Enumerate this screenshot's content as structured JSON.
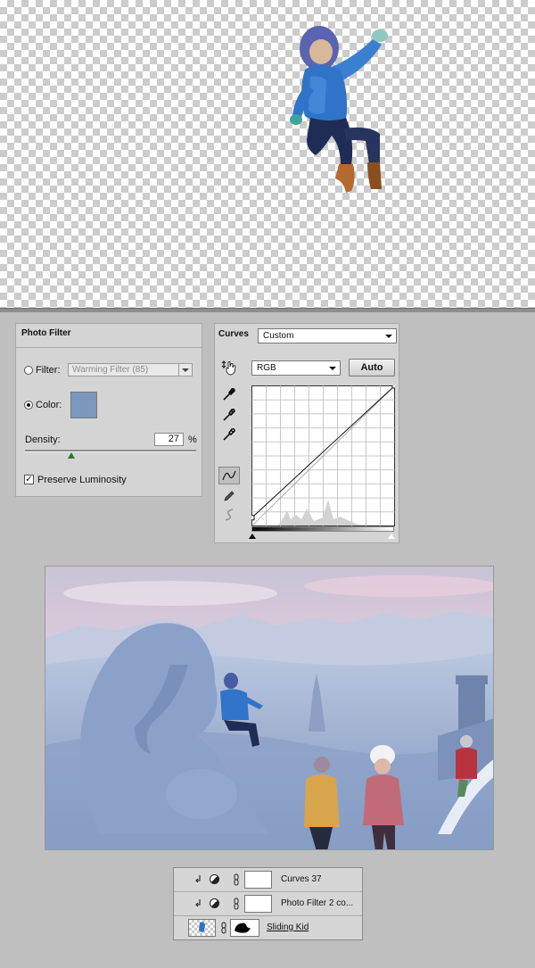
{
  "photo_filter": {
    "title": "Photo Filter",
    "filter_label": "Filter:",
    "filter_value": "Warming Filter (85)",
    "filter_selected": false,
    "color_label": "Color:",
    "color_selected": true,
    "color_swatch": "#7b97bc",
    "density_label": "Density:",
    "density_value": "27",
    "density_unit": "%",
    "preserve_luminosity_label": "Preserve Luminosity",
    "preserve_luminosity_checked": true
  },
  "curves": {
    "title": "Curves",
    "preset_value": "Custom",
    "channel_value": "RGB",
    "auto_label": "Auto",
    "curve_points": [
      [
        0,
        15
      ],
      [
        255,
        255
      ]
    ]
  },
  "layers": [
    {
      "name": "Curves 37",
      "type": "adjustment",
      "clipped": true
    },
    {
      "name": "Photo Filter 2 co...",
      "type": "adjustment",
      "clipped": true
    },
    {
      "name": "Sliding Kid",
      "type": "pixel",
      "clipped": false
    }
  ],
  "colors": {
    "panel_bg": "#d4d4d4",
    "workspace_bg": "#bfbfbf",
    "kid_jacket": "#2f74c8"
  }
}
